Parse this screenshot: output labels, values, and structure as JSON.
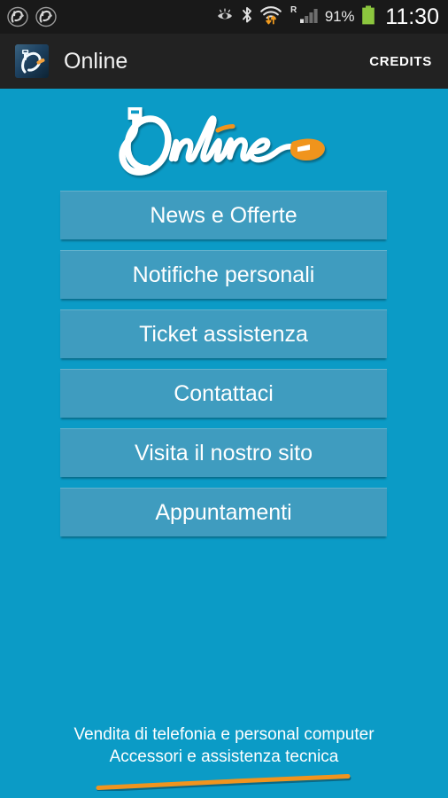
{
  "status_bar": {
    "notification_icons": [
      "app-logo-notification-icon",
      "app-logo-notification-icon"
    ],
    "icons": [
      "eye-icon",
      "bluetooth-icon",
      "wifi-transfer-icon",
      "roaming-r-label",
      "cellular-signal-icon"
    ],
    "roaming_label": "R",
    "battery_percent": "91%",
    "time": "11:30",
    "colors": {
      "background": "#191919",
      "battery_fill": "#8cc63e",
      "text": "#e8e8e8",
      "wifi_arrows": "#f09a1e"
    }
  },
  "action_bar": {
    "icon_name": "app-icon",
    "title": "Online",
    "credits_label": "CREDITS",
    "colors": {
      "background": "#222222",
      "title": "#f2f2f2"
    }
  },
  "logo": {
    "name": "online-usb-script-logo",
    "text": "Online",
    "colors": {
      "script": "#ffffff",
      "accent": "#f0941e"
    }
  },
  "menu": {
    "buttons": [
      {
        "label": "News e Offerte",
        "name": "menu-button-news-e-offerte"
      },
      {
        "label": "Notifiche personali",
        "name": "menu-button-notifiche-personali"
      },
      {
        "label": "Ticket assistenza",
        "name": "menu-button-ticket-assistenza"
      },
      {
        "label": "Contattaci",
        "name": "menu-button-contattaci"
      },
      {
        "label": "Visita il nostro sito",
        "name": "menu-button-visita-il-nostro-sito"
      },
      {
        "label": "Appuntamenti",
        "name": "menu-button-appuntamenti"
      }
    ],
    "colors": {
      "button_fill": "#3f9cbf",
      "button_highlight": "#63b2cd",
      "label": "#ffffff"
    }
  },
  "footer": {
    "line1": "Vendita di telefonia e personal computer",
    "line2": "Accessori e assistenza tecnica",
    "swoosh_color": "#f0941e"
  },
  "page": {
    "background": "#0b9bc6"
  }
}
